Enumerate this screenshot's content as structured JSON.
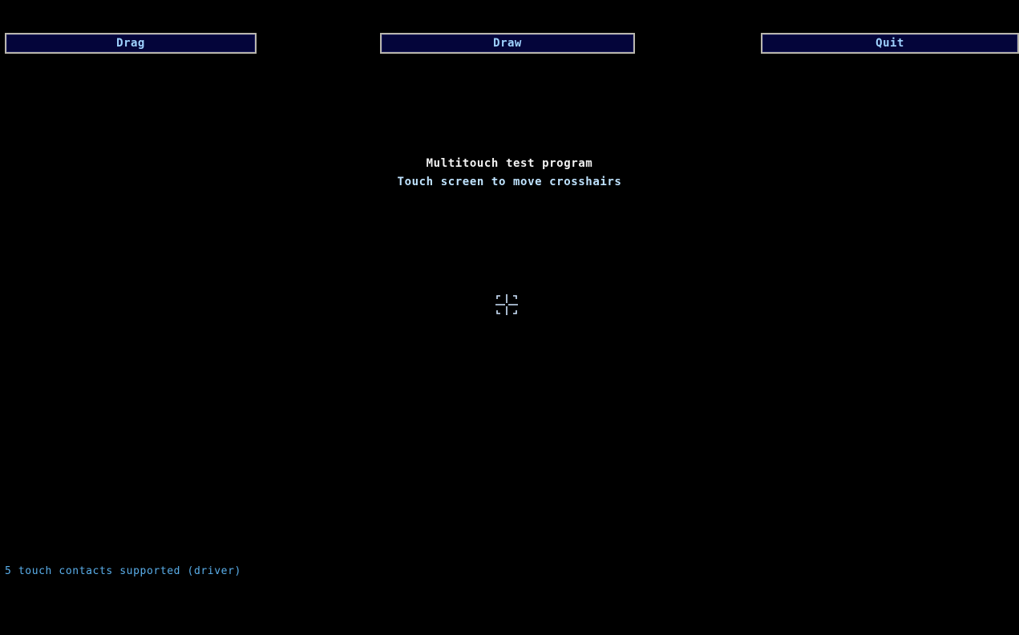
{
  "toolbar": {
    "drag_label": "Drag",
    "draw_label": "Draw",
    "quit_label": "Quit"
  },
  "main": {
    "title": "Multitouch test program",
    "instruction": "Touch screen to move crosshairs"
  },
  "status": {
    "text": "5 touch contacts supported (driver)"
  },
  "icons": {
    "crosshair": "crosshair-icon"
  },
  "colors": {
    "background": "#000000",
    "button_fill": "#04053a",
    "button_border": "#b9b6ad",
    "button_text": "#9fd2ff",
    "title_text": "#f2f2f2",
    "instruction_text": "#bfe3ff",
    "status_text": "#5aaeea",
    "crosshair": "#cfe6ff"
  }
}
